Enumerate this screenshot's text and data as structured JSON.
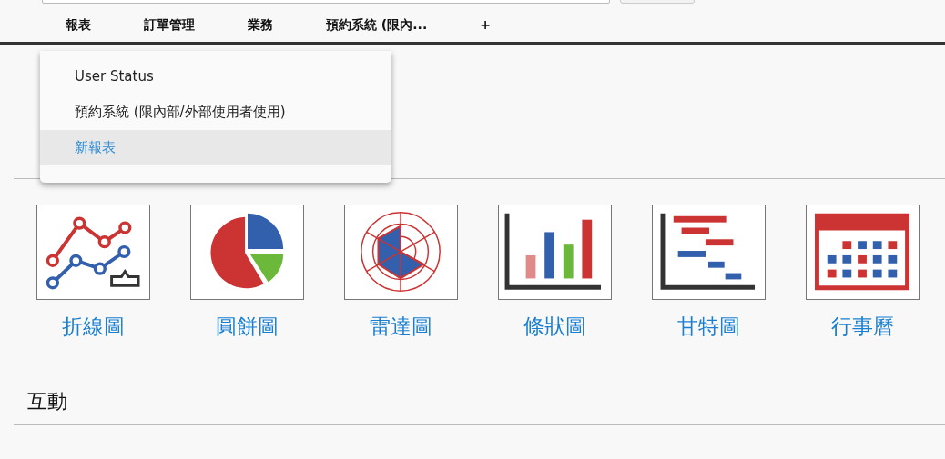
{
  "tabs": [
    {
      "label": "報表"
    },
    {
      "label": "訂單管理"
    },
    {
      "label": "業務"
    },
    {
      "label": "預約系統 (限內..."
    },
    {
      "label": "+"
    }
  ],
  "dropdown": {
    "items": [
      {
        "label": "User Status",
        "selected": false
      },
      {
        "label": "預約系統 (限內部/外部使用者使用)",
        "selected": false
      },
      {
        "label": "新報表",
        "selected": true
      }
    ]
  },
  "sections": [
    {
      "tiles": [
        {
          "kind": "line",
          "label": "折線圖"
        },
        {
          "kind": "pie",
          "label": "圓餅圖"
        },
        {
          "kind": "radar",
          "label": "雷達圖"
        },
        {
          "kind": "bar",
          "label": "條狀圖"
        },
        {
          "kind": "gantt",
          "label": "甘特圖"
        },
        {
          "kind": "calendar",
          "label": "行事曆"
        }
      ]
    },
    {
      "title": "互動"
    }
  ]
}
